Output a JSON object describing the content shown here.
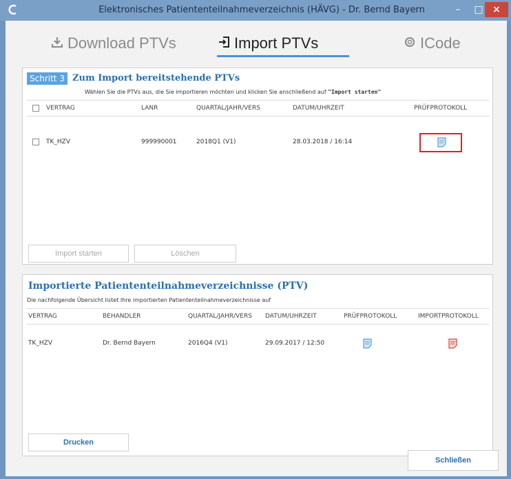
{
  "window": {
    "title": "Elektronisches Patiententeilnahmeverzeichnis (HÄVG) - Dr. Bernd Bayern",
    "min_glyph": "–",
    "max_glyph": "□",
    "close_glyph": "×"
  },
  "tabs": [
    {
      "label": "Download PTVs",
      "icon": "download-icon"
    },
    {
      "label": "Import PTVs",
      "icon": "import-icon",
      "active": true
    },
    {
      "label": "ICode",
      "icon": "gear-icon"
    }
  ],
  "panel1": {
    "step_label": "Schritt 3",
    "title": "Zum Import bereitstehende PTVs",
    "subtitle_prefix": "Wählen Sie die PTVs aus, die Sie importieren möchten und klicken Sie anschließend auf ",
    "subtitle_bold": "\"Import starten\"",
    "columns": [
      "VERTRAG",
      "LANR",
      "QUARTAL/JAHR/VERS",
      "DATUM/UHRZEIT",
      "PRÜFPROTOKOLL"
    ],
    "rows": [
      {
        "vertrag": "TK_HZV",
        "lanr": "999990001",
        "quartal": "2018Q1 (V1)",
        "datum": "28.03.2018 / 16:14"
      }
    ],
    "btn_import": "Import starten",
    "btn_loeschen": "Löschen"
  },
  "panel2": {
    "title": "Importierte Patiententeilnahmeverzeichnisse (PTV)",
    "subtitle": "Die nachfolgende Übersicht listet Ihre importierten Patiententeilnahmeverzeichnisse auf",
    "columns": [
      "VERTRAG",
      "BEHANDLER",
      "QUARTAL/JAHR/VERS",
      "DATUM/UHRZEIT",
      "PRÜFPROTOKOLL",
      "IMPORTPROTOKOLL"
    ],
    "rows": [
      {
        "vertrag": "TK_HZV",
        "behandler": "Dr. Bernd Bayern",
        "quartal": "2016Q4 (V1)",
        "datum": "29.09.2017 / 12:50"
      }
    ],
    "btn_drucken": "Drucken"
  },
  "footer": {
    "btn_schliessen": "Schließen"
  },
  "colors": {
    "accent": "#2a6fb4",
    "step_badge": "#5ca3e0",
    "highlight_box": "#e02020",
    "doc_blue": "#5aa0e0",
    "doc_red": "#e04040"
  }
}
